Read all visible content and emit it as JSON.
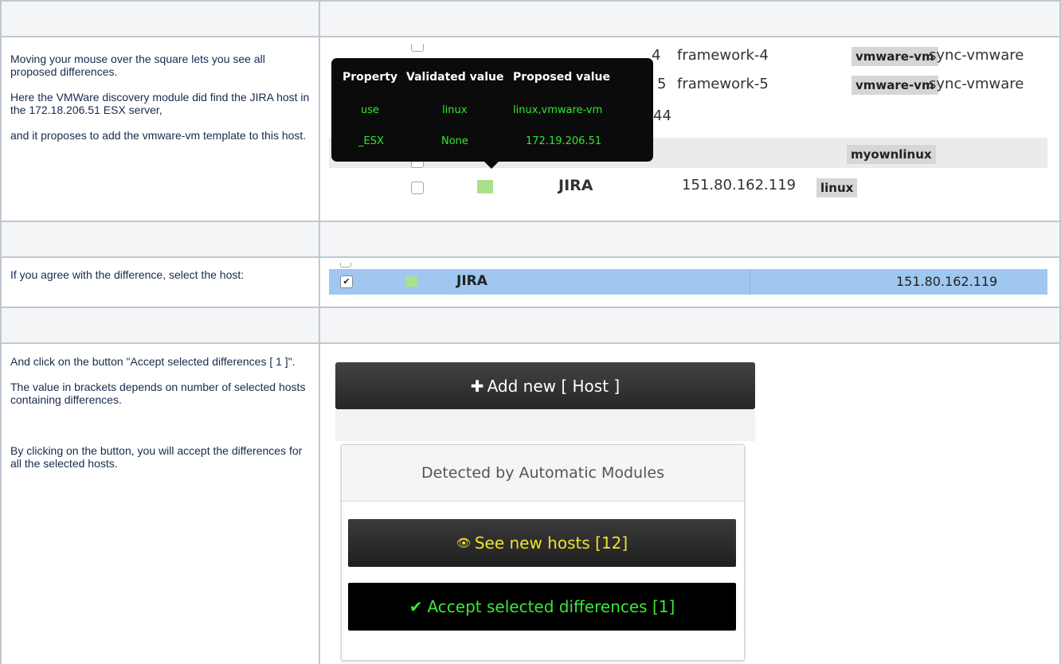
{
  "intro_text": [
    "Moving your mouse over the square lets you see all proposed differences.",
    "Here the VMWare discovery module did find the JIRA host in the 172.18.206.51 ESX server,",
    "and it proposes to add the vmware-vm template to this host."
  ],
  "select_text": "If you agree with the difference, select the host:",
  "accept_text": [
    "And click on the button \"Accept selected differences [ 1 ]\".",
    "The value in brackets depends on number of selected hosts containing differences.",
    "By clicking on the button, you will accept the differences for all the selected hosts."
  ],
  "screenshot1": {
    "rows": [
      {
        "name_partial": "4",
        "alias": "framework-4",
        "templates": [
          "vmware-vm"
        ],
        "extra": "sync-vmware"
      },
      {
        "name_partial": "5",
        "alias": "framework-5",
        "templates": [
          "vmware-vm"
        ],
        "extra": "sync-vmware"
      },
      {
        "name_partial": "44"
      },
      {
        "templates": [
          "myownlinux"
        ]
      },
      {
        "name": "JIRA",
        "address": "151.80.162.119",
        "templates": [
          "linux"
        ]
      }
    ],
    "tooltip": {
      "headers": [
        "Property",
        "Validated value",
        "Proposed value"
      ],
      "rows": [
        [
          "use",
          "linux",
          "linux,vmware-vm"
        ],
        [
          "_ESX",
          "None",
          "172.19.206.51"
        ]
      ]
    },
    "colors": {
      "tooltip_bg": "#0b0b0b",
      "tooltip_value": "#2ee82e",
      "diff_square": "#a8e28a",
      "badge": "#d6d6d6"
    }
  },
  "screenshot2": {
    "checkbox_mark": "✔",
    "name": "JIRA",
    "address": "151.80.162.119",
    "colors": {
      "selected_row": "#9fc7ef",
      "diff_square": "#a8e28a"
    }
  },
  "screenshot3": {
    "add_button": {
      "icon": "plus-icon",
      "glyph": "✚",
      "label": "Add new [ Host ]"
    },
    "panel_title": "Detected by Automatic Modules",
    "see_button": {
      "icon": "eye-icon",
      "glyph": "👁",
      "label": "See new hosts [12]"
    },
    "accept_button": {
      "icon": "check-icon",
      "glyph": "✔",
      "label": "Accept selected differences [1]"
    },
    "colors": {
      "see_text": "#f0e130",
      "accept_text": "#39e839",
      "button_dark": "#2d2d2d"
    }
  }
}
